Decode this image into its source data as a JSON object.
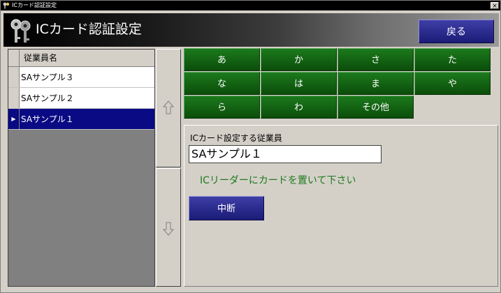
{
  "window": {
    "title": "ICカード認証設定",
    "close_glyph": "×"
  },
  "header": {
    "title": "ICカード認証設定",
    "back_label": "戻る"
  },
  "employee_list": {
    "column_header": "従業員名",
    "rows": [
      {
        "name": "SAサンプル３",
        "selected": false
      },
      {
        "name": "SAサンプル２",
        "selected": false
      },
      {
        "name": "SAサンプル１",
        "selected": true
      }
    ],
    "selected_marker": "▶"
  },
  "kana_filter": {
    "buttons": [
      "あ",
      "か",
      "さ",
      "た",
      "な",
      "は",
      "ま",
      "や",
      "ら",
      "わ",
      "その他"
    ]
  },
  "ic_panel": {
    "label": "ICカード設定する従業員",
    "employee_value": "SAサンプル１",
    "message": "ICリーダーにカードを置いて下さい",
    "stop_label": "中断"
  },
  "colors": {
    "header_dark": "#000000",
    "blue_button": "#1b1b78",
    "green_button": "#0b4d0b",
    "selection": "#0a0a84",
    "message": "#1c7a1c"
  },
  "icons": {
    "app": "keys-icon",
    "scroll_up": "arrow-up-icon",
    "scroll_down": "arrow-down-icon"
  }
}
